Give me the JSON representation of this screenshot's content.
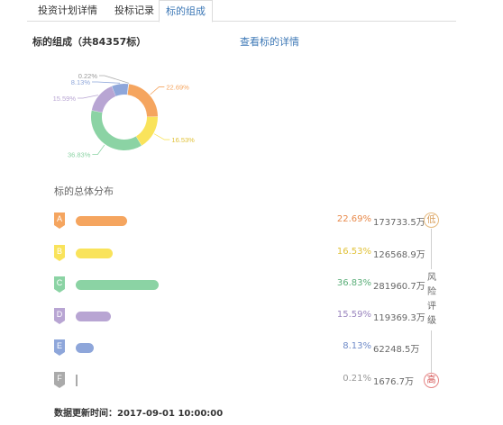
{
  "tabs": [
    {
      "label": "投资计划详情"
    },
    {
      "label": "投标记录"
    },
    {
      "label": "标的组成"
    }
  ],
  "section": {
    "title": "标的组成（共84357标）",
    "view_link": "查看标的详情"
  },
  "chart_data": {
    "type": "pie",
    "variant": "donut",
    "labels": [
      "22.69%",
      "16.53%",
      "36.83%",
      "15.59%",
      "8.13%",
      "0.22%"
    ],
    "values": [
      22.69,
      16.53,
      36.83,
      15.59,
      8.13,
      0.22
    ],
    "colors": [
      "#f5a55f",
      "#f9e35b",
      "#8bd3a4",
      "#b8a5d3",
      "#8ea6da",
      "#cfcfcf"
    ]
  },
  "distribution": {
    "title": "标的总体分布",
    "rows": [
      {
        "grade": "A",
        "percent": "22.69%",
        "amount": "173733.5万",
        "share": 22.69,
        "color": "#f5a55f",
        "text_color": "#e8894a"
      },
      {
        "grade": "B",
        "percent": "16.53%",
        "amount": "126568.9万",
        "share": 16.53,
        "color": "#f9e35b",
        "text_color": "#e1c23a"
      },
      {
        "grade": "C",
        "percent": "36.83%",
        "amount": "281960.7万",
        "share": 36.83,
        "color": "#8bd3a4",
        "text_color": "#5aae78"
      },
      {
        "grade": "D",
        "percent": "15.59%",
        "amount": "119369.3万",
        "share": 15.59,
        "color": "#b8a5d3",
        "text_color": "#9b86bf"
      },
      {
        "grade": "E",
        "percent": "8.13%",
        "amount": "62248.5万",
        "share": 8.13,
        "color": "#8ea6da",
        "text_color": "#6e8ac8"
      },
      {
        "grade": "F",
        "percent": "0.21%",
        "amount": "1676.7万",
        "share": 0.21,
        "color": "#aaaaaa",
        "text_color": "#999999"
      }
    ]
  },
  "risk": {
    "low": "低",
    "high": "高",
    "label_chars": [
      "风",
      "险",
      "评",
      "级"
    ]
  },
  "update": {
    "text": "数据更新时间：2017-09-01 10:00:00"
  }
}
